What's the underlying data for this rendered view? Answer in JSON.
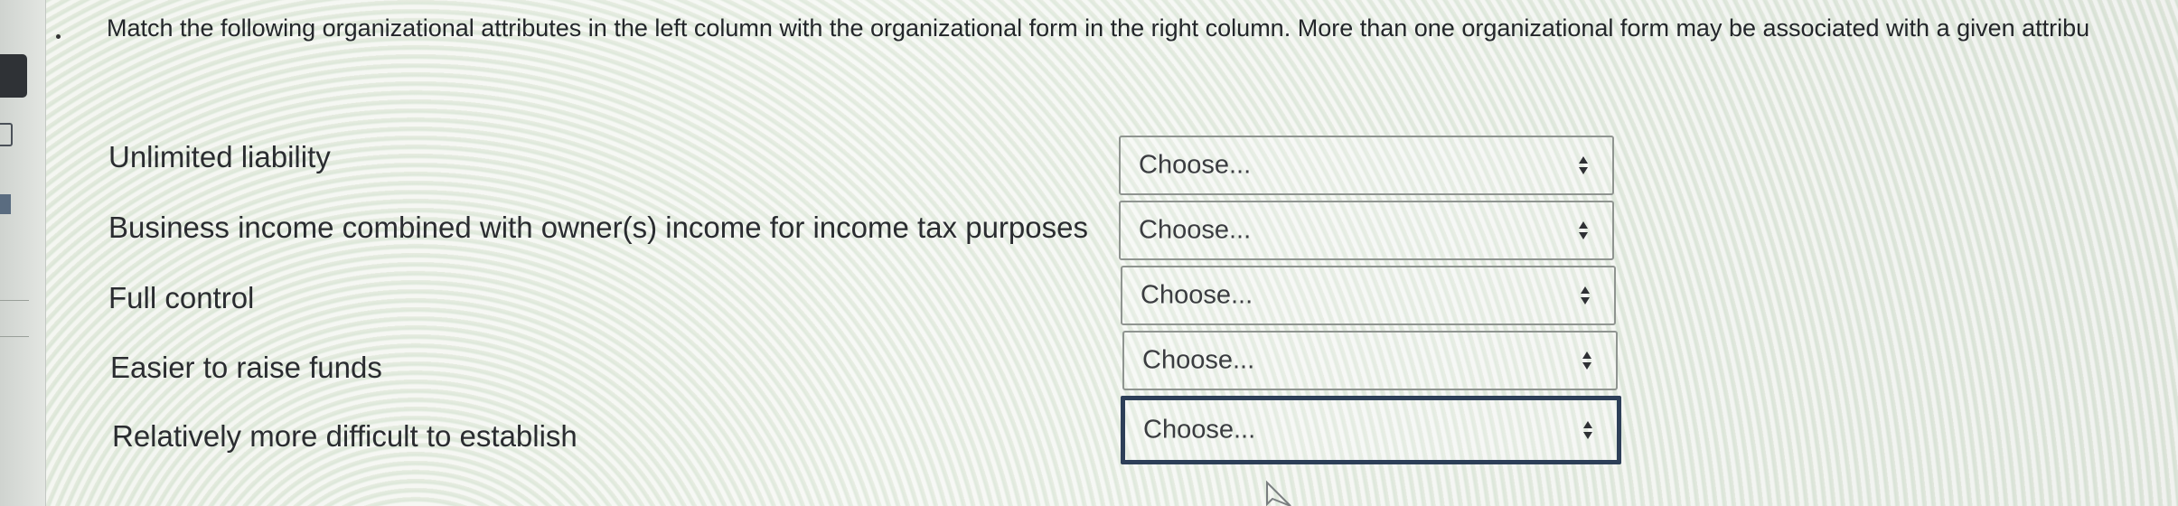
{
  "question": {
    "instructions": "Match the following organizational attributes in the left column with the organizational form in the right column. More than one organizational form may be associated with a given attribu"
  },
  "rows": [
    {
      "attribute": "Unlimited liability",
      "select_value": "Choose..."
    },
    {
      "attribute": "Business income combined with owner(s) income for income tax purposes",
      "select_value": "Choose..."
    },
    {
      "attribute": "Full control",
      "select_value": "Choose..."
    },
    {
      "attribute": "Easier to raise funds",
      "select_value": "Choose..."
    },
    {
      "attribute": "Relatively more difficult to establish",
      "select_value": "Choose..."
    }
  ],
  "icons": {
    "select_arrows": "up-down-arrows-icon",
    "cursor": "mouse-pointer-icon"
  },
  "colors": {
    "focus_border": "#2d3f58",
    "select_border": "#8f9490"
  }
}
